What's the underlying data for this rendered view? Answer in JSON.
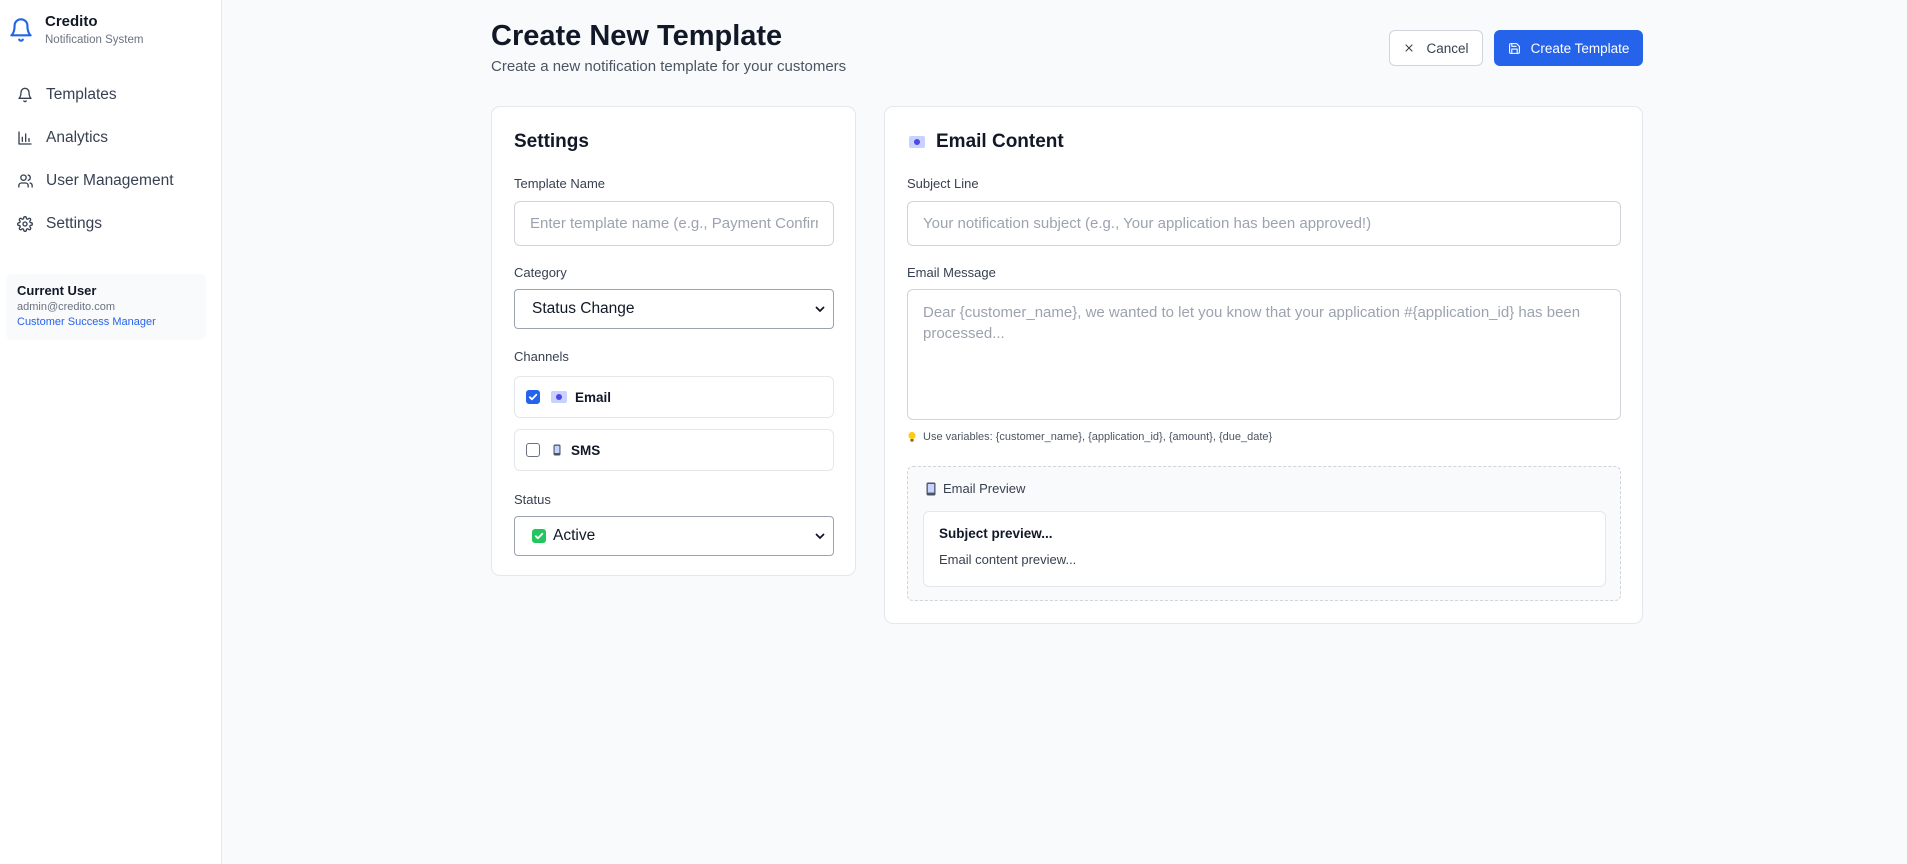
{
  "app": {
    "name": "Credito",
    "subtitle": "Notification System"
  },
  "sidebar": {
    "items": [
      {
        "label": "Templates",
        "icon": "bell-icon"
      },
      {
        "label": "Analytics",
        "icon": "bar-chart-icon"
      },
      {
        "label": "User Management",
        "icon": "users-icon"
      },
      {
        "label": "Settings",
        "icon": "gear-icon"
      }
    ],
    "user": {
      "title": "Current User",
      "email": "admin@credito.com",
      "role": "Customer Success Manager"
    }
  },
  "header": {
    "title": "Create New Template",
    "subtitle": "Create a new notification template for your customers",
    "cancel_label": "Cancel",
    "create_label": "Create Template"
  },
  "settings": {
    "title": "Settings",
    "template_name_label": "Template Name",
    "template_name_placeholder": "Enter template name (e.g., Payment Confirmation)",
    "template_name_value": "",
    "category_label": "Category",
    "category_value": "Status Change",
    "channels_label": "Channels",
    "channels": [
      {
        "label": "Email",
        "checked": true,
        "icon": "email-icon"
      },
      {
        "label": "SMS",
        "checked": false,
        "icon": "phone-icon"
      }
    ],
    "status_label": "Status",
    "status_value": "Active"
  },
  "email": {
    "title": "Email Content",
    "subject_label": "Subject Line",
    "subject_placeholder": "Your notification subject (e.g., Your application has been approved!)",
    "subject_value": "",
    "message_label": "Email Message",
    "message_placeholder": "Dear {customer_name}, we wanted to let you know that your application #{application_id} has been processed...",
    "message_value": "",
    "hint": "Use variables: {customer_name}, {application_id}, {amount}, {due_date}",
    "preview": {
      "title": "Email Preview",
      "subject": "Subject preview...",
      "body": "Email content preview..."
    }
  },
  "colors": {
    "primary": "#2563eb",
    "status_active": "#22c55e"
  }
}
